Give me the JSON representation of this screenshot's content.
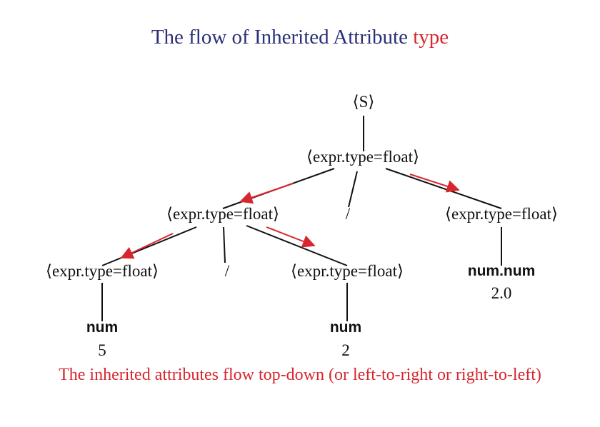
{
  "title": {
    "prefix": "The flow of Inherited Attribute ",
    "highlight": "type"
  },
  "tree": {
    "root": "⟨S⟩",
    "expr_top": "⟨expr.type=float⟩",
    "expr_left": "⟨expr.type=float⟩",
    "div_top": "/",
    "expr_right": "⟨expr.type=float⟩",
    "expr_ll": "⟨expr.type=float⟩",
    "div_mid": "/",
    "expr_lr": "⟨expr.type=float⟩",
    "tok_right": "num.num",
    "val_right": "2.0",
    "tok_ll": "num",
    "val_ll": "5",
    "tok_lr": "num",
    "val_lr": "2"
  },
  "footer": "The inherited attributes flow top-down (or left-to-right or right-to-left)",
  "colors": {
    "title": "#2a2f78",
    "accent": "#d8262e",
    "text": "#111111"
  }
}
